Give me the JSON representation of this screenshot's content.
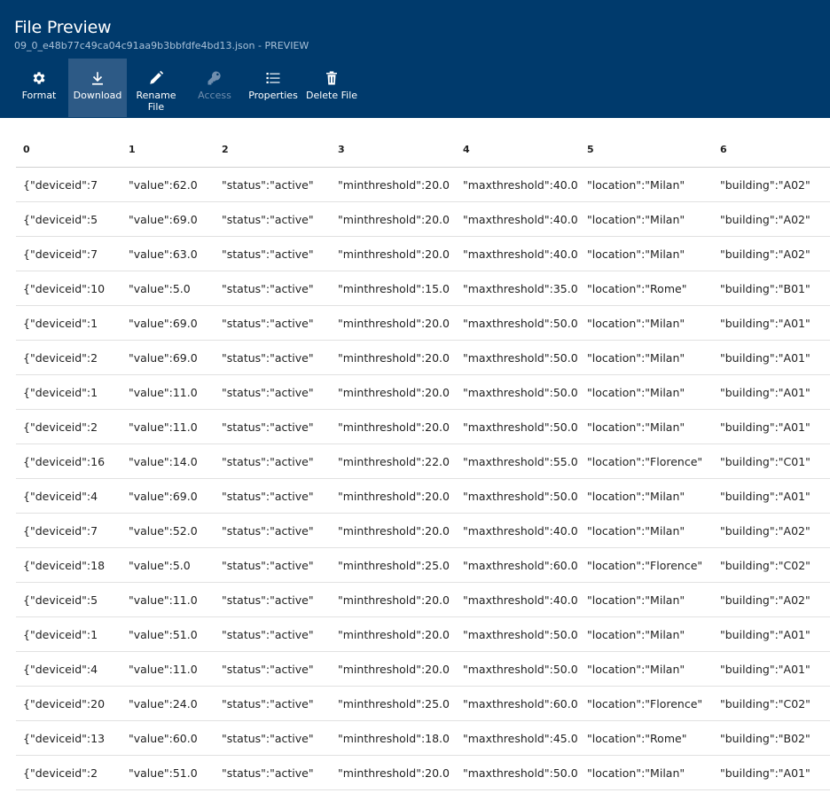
{
  "header": {
    "title": "File Preview",
    "subtitle": "09_0_e48b77c49ca04c91aa9b3bbfdfe4bd13.json - PREVIEW"
  },
  "toolbar": [
    {
      "id": "format",
      "label": "Format",
      "icon": "gear-icon",
      "active": false,
      "disabled": false
    },
    {
      "id": "download",
      "label": "Download",
      "icon": "download-icon",
      "active": true,
      "disabled": false
    },
    {
      "id": "rename",
      "label": "Rename File",
      "icon": "pencil-icon",
      "active": false,
      "disabled": false
    },
    {
      "id": "access",
      "label": "Access",
      "icon": "key-icon",
      "active": false,
      "disabled": true
    },
    {
      "id": "properties",
      "label": "Properties",
      "icon": "list-icon",
      "active": false,
      "disabled": false
    },
    {
      "id": "delete",
      "label": "Delete File",
      "icon": "trash-icon",
      "active": false,
      "disabled": false
    }
  ],
  "table": {
    "columns": [
      "0",
      "1",
      "2",
      "3",
      "4",
      "5",
      "6"
    ],
    "rows": [
      [
        "{\"deviceid\":7",
        "\"value\":62.0",
        "\"status\":\"active\"",
        "\"minthreshold\":20.0",
        "\"maxthreshold\":40.0",
        "\"location\":\"Milan\"",
        "\"building\":\"A02\""
      ],
      [
        "{\"deviceid\":5",
        "\"value\":69.0",
        "\"status\":\"active\"",
        "\"minthreshold\":20.0",
        "\"maxthreshold\":40.0",
        "\"location\":\"Milan\"",
        "\"building\":\"A02\""
      ],
      [
        "{\"deviceid\":7",
        "\"value\":63.0",
        "\"status\":\"active\"",
        "\"minthreshold\":20.0",
        "\"maxthreshold\":40.0",
        "\"location\":\"Milan\"",
        "\"building\":\"A02\""
      ],
      [
        "{\"deviceid\":10",
        "\"value\":5.0",
        "\"status\":\"active\"",
        "\"minthreshold\":15.0",
        "\"maxthreshold\":35.0",
        "\"location\":\"Rome\"",
        "\"building\":\"B01\""
      ],
      [
        "{\"deviceid\":1",
        "\"value\":69.0",
        "\"status\":\"active\"",
        "\"minthreshold\":20.0",
        "\"maxthreshold\":50.0",
        "\"location\":\"Milan\"",
        "\"building\":\"A01\""
      ],
      [
        "{\"deviceid\":2",
        "\"value\":69.0",
        "\"status\":\"active\"",
        "\"minthreshold\":20.0",
        "\"maxthreshold\":50.0",
        "\"location\":\"Milan\"",
        "\"building\":\"A01\""
      ],
      [
        "{\"deviceid\":1",
        "\"value\":11.0",
        "\"status\":\"active\"",
        "\"minthreshold\":20.0",
        "\"maxthreshold\":50.0",
        "\"location\":\"Milan\"",
        "\"building\":\"A01\""
      ],
      [
        "{\"deviceid\":2",
        "\"value\":11.0",
        "\"status\":\"active\"",
        "\"minthreshold\":20.0",
        "\"maxthreshold\":50.0",
        "\"location\":\"Milan\"",
        "\"building\":\"A01\""
      ],
      [
        "{\"deviceid\":16",
        "\"value\":14.0",
        "\"status\":\"active\"",
        "\"minthreshold\":22.0",
        "\"maxthreshold\":55.0",
        "\"location\":\"Florence\"",
        "\"building\":\"C01\""
      ],
      [
        "{\"deviceid\":4",
        "\"value\":69.0",
        "\"status\":\"active\"",
        "\"minthreshold\":20.0",
        "\"maxthreshold\":50.0",
        "\"location\":\"Milan\"",
        "\"building\":\"A01\""
      ],
      [
        "{\"deviceid\":7",
        "\"value\":52.0",
        "\"status\":\"active\"",
        "\"minthreshold\":20.0",
        "\"maxthreshold\":40.0",
        "\"location\":\"Milan\"",
        "\"building\":\"A02\""
      ],
      [
        "{\"deviceid\":18",
        "\"value\":5.0",
        "\"status\":\"active\"",
        "\"minthreshold\":25.0",
        "\"maxthreshold\":60.0",
        "\"location\":\"Florence\"",
        "\"building\":\"C02\""
      ],
      [
        "{\"deviceid\":5",
        "\"value\":11.0",
        "\"status\":\"active\"",
        "\"minthreshold\":20.0",
        "\"maxthreshold\":40.0",
        "\"location\":\"Milan\"",
        "\"building\":\"A02\""
      ],
      [
        "{\"deviceid\":1",
        "\"value\":51.0",
        "\"status\":\"active\"",
        "\"minthreshold\":20.0",
        "\"maxthreshold\":50.0",
        "\"location\":\"Milan\"",
        "\"building\":\"A01\""
      ],
      [
        "{\"deviceid\":4",
        "\"value\":11.0",
        "\"status\":\"active\"",
        "\"minthreshold\":20.0",
        "\"maxthreshold\":50.0",
        "\"location\":\"Milan\"",
        "\"building\":\"A01\""
      ],
      [
        "{\"deviceid\":20",
        "\"value\":24.0",
        "\"status\":\"active\"",
        "\"minthreshold\":25.0",
        "\"maxthreshold\":60.0",
        "\"location\":\"Florence\"",
        "\"building\":\"C02\""
      ],
      [
        "{\"deviceid\":13",
        "\"value\":60.0",
        "\"status\":\"active\"",
        "\"minthreshold\":18.0",
        "\"maxthreshold\":45.0",
        "\"location\":\"Rome\"",
        "\"building\":\"B02\""
      ],
      [
        "{\"deviceid\":2",
        "\"value\":51.0",
        "\"status\":\"active\"",
        "\"minthreshold\":20.0",
        "\"maxthreshold\":50.0",
        "\"location\":\"Milan\"",
        "\"building\":\"A01\""
      ]
    ]
  }
}
